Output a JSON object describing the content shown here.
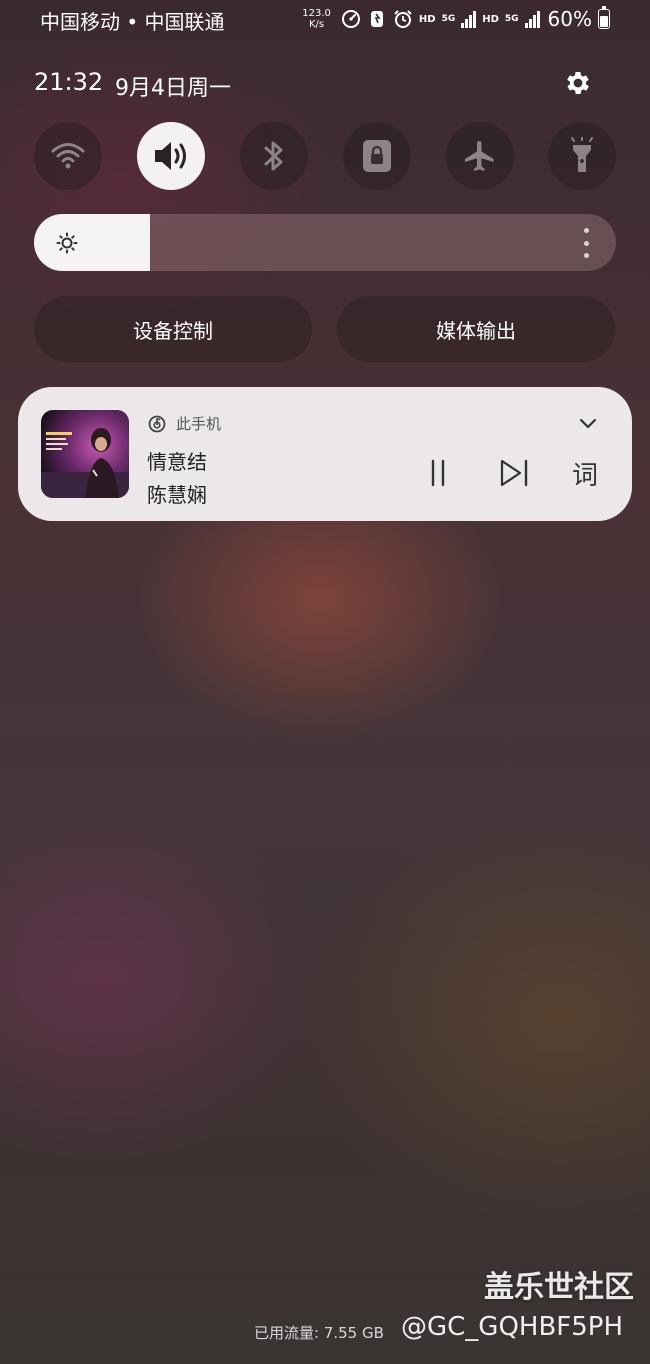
{
  "status_bar": {
    "carriers": "中国移动 • 中国联通",
    "net_speed_value": "123.0",
    "net_speed_unit": "K/s",
    "hd_1": "HD",
    "network_1": "5G",
    "hd_2": "HD",
    "network_2": "5G",
    "battery_percent": "60%",
    "battery_level": 0.6
  },
  "header": {
    "time": "21:32",
    "date": "9月4日周一"
  },
  "quick_toggles": [
    {
      "icon": "wifi-icon",
      "active": false
    },
    {
      "icon": "sound-icon",
      "active": true
    },
    {
      "icon": "bluetooth-icon",
      "active": false
    },
    {
      "icon": "rotation-lock-icon",
      "active": false
    },
    {
      "icon": "airplane-icon",
      "active": false
    },
    {
      "icon": "flashlight-icon",
      "active": false
    }
  ],
  "brightness": {
    "level": 0.2
  },
  "buttons": {
    "device_control": "设备控制",
    "media_output": "媒体输出"
  },
  "media": {
    "source": "此手机",
    "title": "情意结",
    "artist": "陈慧娴",
    "lyrics_label": "词",
    "album_cover_text": "陈慧娴"
  },
  "footer": {
    "data_usage": "已用流量: 7.55 GB",
    "watermark": "盖乐世社区",
    "user_tag": "@GC_GQHBF5PH"
  },
  "colors": {
    "toggle_active": "#f4f1f2",
    "card_background": "#ece8e9"
  }
}
